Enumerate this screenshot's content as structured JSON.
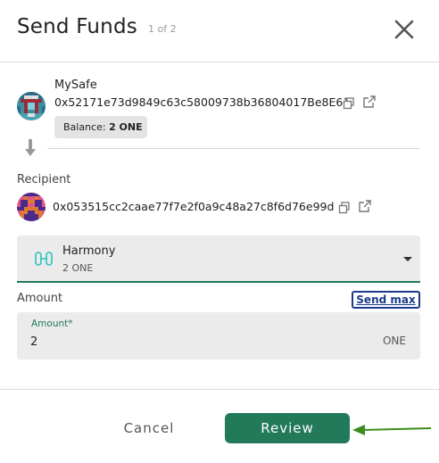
{
  "header": {
    "title": "Send Funds",
    "step": "1 of 2"
  },
  "sender": {
    "name": "MySafe",
    "address": "0x52171e73d9849c63c58009738b36804017Be8E61",
    "balance_label": "Balance:",
    "balance_value": "2 ONE"
  },
  "recipient": {
    "label": "Recipient",
    "address": "0x053515cc2caae77f7e2f0a9c48a27c8f6d76e99d"
  },
  "token": {
    "name": "Harmony",
    "balance": "2 ONE"
  },
  "amount": {
    "section_label": "Amount",
    "send_max_label": "Send max",
    "field_label": "Amount*",
    "value": "2",
    "unit": "ONE"
  },
  "footer": {
    "cancel_label": "Cancel",
    "review_label": "Review"
  },
  "colors": {
    "primary": "#237a5a",
    "link": "#1a3c8a",
    "annotation_arrow": "#3c8c1c"
  },
  "icons": [
    "close-icon",
    "copy-icon",
    "external-link-icon",
    "arrow-down-icon",
    "harmony-token-icon",
    "chevron-down-icon"
  ]
}
